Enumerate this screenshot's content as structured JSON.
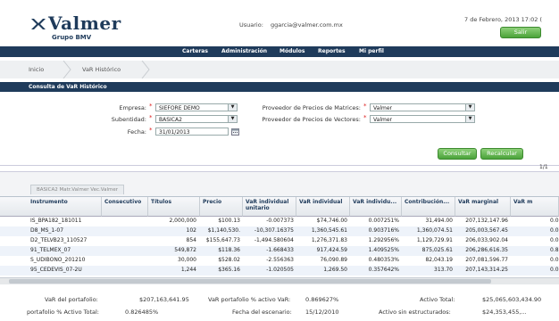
{
  "header": {
    "brand": "Valmer",
    "brand_sub": "Grupo BMV",
    "user_label": "Usuario:",
    "user_email": "ggarcia@valmer.com.mx",
    "date": "7 de Febrero, 2013 17:02 (",
    "logout_label": "Salir"
  },
  "nav": {
    "items": [
      "Carteras",
      "Administración",
      "Módulos",
      "Reportes",
      "Mi perfil"
    ]
  },
  "breadcrumb": {
    "items": [
      "Inicio",
      "VaR Histórico"
    ]
  },
  "panel": {
    "title": "Consulta de VaR Histórico"
  },
  "form": {
    "empresa_label": "Empresa:",
    "empresa_value": "SIEFORE DEMO",
    "subentidad_label": "Subentidad:",
    "subentidad_value": "BASICA2",
    "fecha_label": "Fecha:",
    "fecha_value": "31/01/2013",
    "prov_matrices_label": "Proveedor de Precios de Matrices:",
    "prov_matrices_value": "Valmer",
    "prov_vectores_label": "Proveedor de Precios de Vectores:",
    "prov_vectores_value": "Valmer",
    "consultar_label": "Consultar",
    "recalcular_label": "Recalcular",
    "pager": "1/1"
  },
  "tab": {
    "label": "BASICA2 Matr.Valmer Vec.Valmer"
  },
  "table": {
    "columns": [
      "Instrumento",
      "Consecutivo",
      "Títulos",
      "Precio",
      "VaR individual unitario",
      "VaR individual",
      "VaR individu...",
      "Contribución...",
      "VaR marginal",
      "VaR m"
    ],
    "rows": [
      [
        "IS_BPA182_181011",
        "",
        "2,000,000",
        "$100.13",
        "-0.007373",
        "$74,746.00",
        "0.007251%",
        "31,494.00",
        "207,132,147.96",
        "0.0"
      ],
      [
        "D8_MS_1-07",
        "",
        "102",
        "$1,140,530.",
        "-10,307.16375",
        "1,360,545.61",
        "0.903716%",
        "1,360,074.51",
        "205,003,567.45",
        "0.0"
      ],
      [
        "D2_TELVB23_110527",
        "",
        "854",
        "$155,647.73",
        "-1,494.580604",
        "1,276,371.83",
        "1.292956%",
        "1,129,729.91",
        "206,033,902.04",
        "0.0"
      ],
      [
        "91_TELMEX_07",
        "",
        "549,872",
        "$118.36",
        "-1.668433",
        "917,424.59",
        "1.409525%",
        "875,025.61",
        "206,286,616.35",
        "0.8"
      ],
      [
        "S_UDIBONO_201210",
        "",
        "30,000",
        "$528.02",
        "-2.556363",
        "76,090.89",
        "0.480353%",
        "82,043.19",
        "207,081,596.77",
        "0.0"
      ],
      [
        "95_CEDEVIS_07-2U",
        "",
        "1,244",
        "$365.16",
        "-1.020505",
        "1,269.50",
        "0.357642%",
        "313.70",
        "207,143,314.25",
        "0.0"
      ]
    ]
  },
  "footer": {
    "var_portafolio_label": "VaR del portafolio:",
    "var_portafolio_value": "$207,163,641.95",
    "var_pct_label": "VaR portafolio % activo VaR:",
    "var_pct_value": "0.869627%",
    "activo_total_label": "Activo Total:",
    "activo_total_value": "$25,065,603,434.90",
    "portafolio_activo_label": "portafolio % Activo Total:",
    "portafolio_activo_value": "0.826485%",
    "fecha_escenario_label": "Fecha del escenario:",
    "fecha_escenario_value": "15/12/2010",
    "activo_sin_label": "Activo sin estructurados:",
    "activo_sin_value": "$24,353,455,..."
  },
  "colors": {
    "navy": "#1f3b5b",
    "green": "#4aa33a",
    "required": "#dd2222"
  }
}
